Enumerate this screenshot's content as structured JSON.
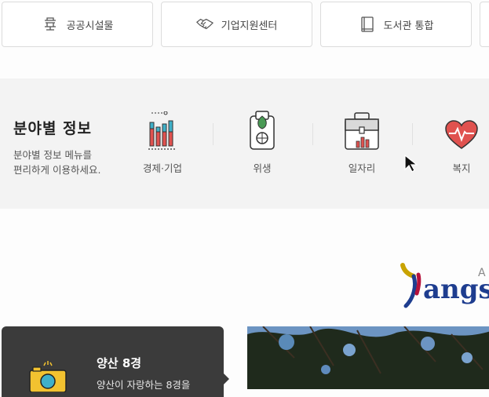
{
  "quick_links": [
    {
      "label": "공공시설물",
      "icon": "building-icon"
    },
    {
      "label": "기업지원센터",
      "icon": "handshake-icon"
    },
    {
      "label": "도서관 통합",
      "icon": "book-icon"
    }
  ],
  "field_info": {
    "title": "분야별 정보",
    "description_line1": "분야별 정보 메뉴를",
    "description_line2": "편리하게 이용하세요.",
    "categories": [
      {
        "label": "경제·기업",
        "icon": "bar-chart-icon"
      },
      {
        "label": "위생",
        "icon": "hygiene-icon"
      },
      {
        "label": "일자리",
        "icon": "briefcase-icon"
      },
      {
        "label": "복지",
        "icon": "heart-pulse-icon"
      }
    ]
  },
  "scenic": {
    "title": "양산 8경",
    "subtitle": "양산이 자랑하는 8경을"
  },
  "colors": {
    "band_bg": "#f3f3f3",
    "panel_dark": "#3b3b3b",
    "accent_red": "#e0524f",
    "accent_teal": "#3fb0c8"
  }
}
